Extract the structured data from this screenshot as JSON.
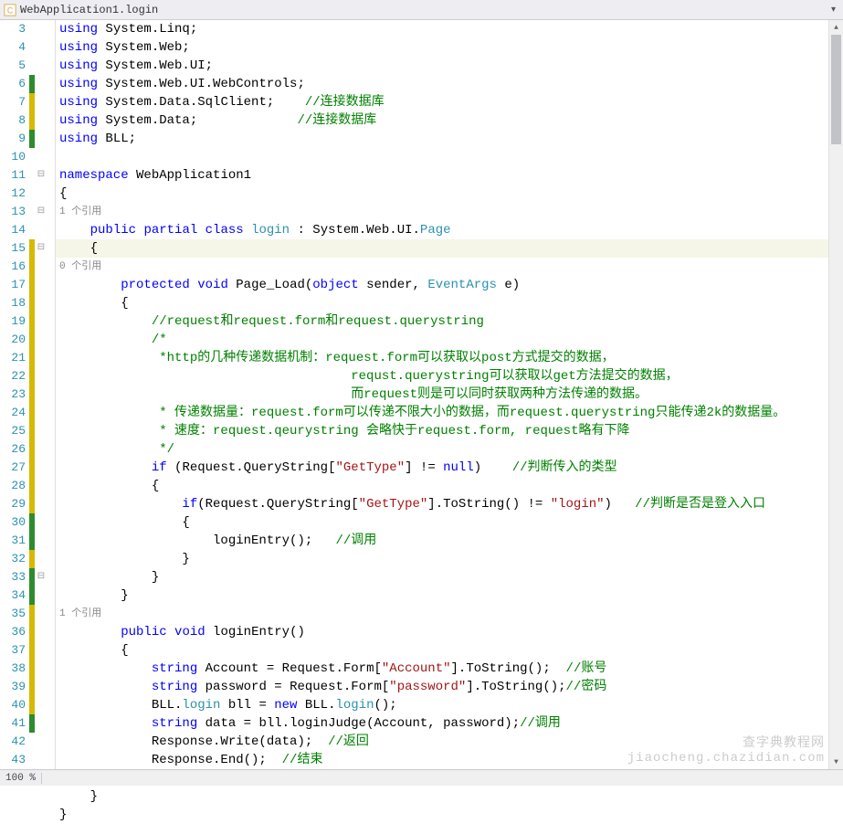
{
  "title": "WebApplication1.login",
  "bottom_tab": "100 %",
  "watermark": "查字典教程网\njiaocheng.chazidian.com",
  "refs": {
    "one": "1 个引用",
    "zero": "0 个引用"
  },
  "code": {
    "l3": {
      "num": "3",
      "marker": "",
      "fold": "",
      "tokens": [
        {
          "c": "kw",
          "t": "using"
        },
        {
          "c": "txt",
          "t": " System.Linq;"
        }
      ]
    },
    "l4": {
      "num": "4",
      "marker": "",
      "fold": "",
      "tokens": [
        {
          "c": "kw",
          "t": "using"
        },
        {
          "c": "txt",
          "t": " System.Web;"
        }
      ]
    },
    "l5": {
      "num": "5",
      "marker": "",
      "fold": "",
      "tokens": [
        {
          "c": "kw",
          "t": "using"
        },
        {
          "c": "txt",
          "t": " System.Web.UI;"
        }
      ]
    },
    "l6": {
      "num": "6",
      "marker": "m-green",
      "fold": "",
      "tokens": [
        {
          "c": "kw",
          "t": "using"
        },
        {
          "c": "txt",
          "t": " System.Web.UI.WebControls;"
        }
      ]
    },
    "l7": {
      "num": "7",
      "marker": "m-yellow",
      "fold": "",
      "tokens": [
        {
          "c": "kw",
          "t": "using"
        },
        {
          "c": "txt",
          "t": " System.Data.SqlClient;    "
        },
        {
          "c": "com",
          "t": "//连接数据库"
        }
      ]
    },
    "l8": {
      "num": "8",
      "marker": "m-yellow",
      "fold": "",
      "tokens": [
        {
          "c": "kw",
          "t": "using"
        },
        {
          "c": "txt",
          "t": " System.Data;             "
        },
        {
          "c": "com",
          "t": "//连接数据库"
        }
      ]
    },
    "l9": {
      "num": "9",
      "marker": "m-green",
      "fold": "",
      "tokens": [
        {
          "c": "kw",
          "t": "using"
        },
        {
          "c": "txt",
          "t": " BLL;"
        }
      ]
    },
    "l10": {
      "num": "10",
      "marker": "",
      "fold": "",
      "tokens": [
        {
          "c": "txt",
          "t": ""
        }
      ]
    },
    "l11": {
      "num": "11",
      "marker": "",
      "fold": "⊟",
      "tokens": [
        {
          "c": "kw",
          "t": "namespace"
        },
        {
          "c": "txt",
          "t": " WebApplication1"
        }
      ]
    },
    "l12": {
      "num": "12",
      "marker": "",
      "fold": "",
      "tokens": [
        {
          "c": "txt",
          "t": "{"
        }
      ]
    },
    "r1": {
      "indent": "        ",
      "ref": "one"
    },
    "l13": {
      "num": "13",
      "marker": "",
      "fold": "⊟",
      "tokens": [
        {
          "c": "txt",
          "t": "    "
        },
        {
          "c": "kw",
          "t": "public"
        },
        {
          "c": "txt",
          "t": " "
        },
        {
          "c": "kw",
          "t": "partial"
        },
        {
          "c": "txt",
          "t": " "
        },
        {
          "c": "kw",
          "t": "class"
        },
        {
          "c": "txt",
          "t": " "
        },
        {
          "c": "type",
          "t": "login"
        },
        {
          "c": "txt",
          "t": " : System.Web.UI."
        },
        {
          "c": "type",
          "t": "Page"
        }
      ]
    },
    "l14": {
      "num": "14",
      "marker": "",
      "fold": "",
      "highlight": true,
      "tokens": [
        {
          "c": "txt",
          "t": "    {"
        }
      ]
    },
    "r2": {
      "indent": "            ",
      "ref": "zero"
    },
    "l15": {
      "num": "15",
      "marker": "m-yellow",
      "fold": "⊟",
      "tokens": [
        {
          "c": "txt",
          "t": "        "
        },
        {
          "c": "kw",
          "t": "protected"
        },
        {
          "c": "txt",
          "t": " "
        },
        {
          "c": "kw",
          "t": "void"
        },
        {
          "c": "txt",
          "t": " Page_Load("
        },
        {
          "c": "kw",
          "t": "object"
        },
        {
          "c": "txt",
          "t": " sender, "
        },
        {
          "c": "type",
          "t": "EventArgs"
        },
        {
          "c": "txt",
          "t": " e)"
        }
      ]
    },
    "l16": {
      "num": "16",
      "marker": "m-yellow",
      "fold": "",
      "tokens": [
        {
          "c": "txt",
          "t": "        {"
        }
      ]
    },
    "l17": {
      "num": "17",
      "marker": "m-yellow",
      "fold": "",
      "tokens": [
        {
          "c": "txt",
          "t": "            "
        },
        {
          "c": "com",
          "t": "//request和request.form和request.querystring"
        }
      ]
    },
    "l18": {
      "num": "18",
      "marker": "m-yellow",
      "fold": "",
      "tokens": [
        {
          "c": "txt",
          "t": "            "
        },
        {
          "c": "com",
          "t": "/*"
        }
      ]
    },
    "l19": {
      "num": "19",
      "marker": "m-yellow",
      "fold": "",
      "tokens": [
        {
          "c": "txt",
          "t": "             "
        },
        {
          "c": "com",
          "t": "*http的几种传递数据机制：request.form可以获取以post方式提交的数据，"
        }
      ]
    },
    "l20": {
      "num": "20",
      "marker": "m-yellow",
      "fold": "",
      "tokens": [
        {
          "c": "txt",
          "t": "             "
        },
        {
          "c": "com",
          "t": "                         requst.querystring可以获取以get方法提交的数据，"
        }
      ]
    },
    "l21": {
      "num": "21",
      "marker": "m-yellow",
      "fold": "",
      "tokens": [
        {
          "c": "txt",
          "t": "             "
        },
        {
          "c": "com",
          "t": "                         而request则是可以同时获取两种方法传递的数据。"
        }
      ]
    },
    "l22": {
      "num": "22",
      "marker": "m-yellow",
      "fold": "",
      "tokens": [
        {
          "c": "txt",
          "t": "             "
        },
        {
          "c": "com",
          "t": "* 传递数据量：request.form可以传递不限大小的数据，而request.querystring只能传递2k的数据量。"
        }
      ]
    },
    "l23": {
      "num": "23",
      "marker": "m-yellow",
      "fold": "",
      "tokens": [
        {
          "c": "txt",
          "t": "             "
        },
        {
          "c": "com",
          "t": "* 速度：request.qeurystring 会略快于request.form, request略有下降"
        }
      ]
    },
    "l24": {
      "num": "24",
      "marker": "m-yellow",
      "fold": "",
      "tokens": [
        {
          "c": "txt",
          "t": "             "
        },
        {
          "c": "com",
          "t": "*/"
        }
      ]
    },
    "l25": {
      "num": "25",
      "marker": "m-yellow",
      "fold": "",
      "tokens": [
        {
          "c": "txt",
          "t": "            "
        },
        {
          "c": "kw",
          "t": "if"
        },
        {
          "c": "txt",
          "t": " (Request.QueryString["
        },
        {
          "c": "str",
          "t": "\"GetType\""
        },
        {
          "c": "txt",
          "t": "] != "
        },
        {
          "c": "kw",
          "t": "null"
        },
        {
          "c": "txt",
          "t": ")    "
        },
        {
          "c": "com",
          "t": "//判断传入的类型"
        }
      ]
    },
    "l26": {
      "num": "26",
      "marker": "m-yellow",
      "fold": "",
      "tokens": [
        {
          "c": "txt",
          "t": "            {"
        }
      ]
    },
    "l27": {
      "num": "27",
      "marker": "m-yellow",
      "fold": "",
      "tokens": [
        {
          "c": "txt",
          "t": "                "
        },
        {
          "c": "kw",
          "t": "if"
        },
        {
          "c": "txt",
          "t": "(Request.QueryString["
        },
        {
          "c": "str",
          "t": "\"GetType\""
        },
        {
          "c": "txt",
          "t": "].ToString() != "
        },
        {
          "c": "str",
          "t": "\"login\""
        },
        {
          "c": "txt",
          "t": ")   "
        },
        {
          "c": "com",
          "t": "//判断是否是登入入口"
        }
      ]
    },
    "l28": {
      "num": "28",
      "marker": "m-yellow",
      "fold": "",
      "tokens": [
        {
          "c": "txt",
          "t": "                {"
        }
      ]
    },
    "l29": {
      "num": "29",
      "marker": "m-yellow",
      "fold": "",
      "tokens": [
        {
          "c": "txt",
          "t": "                    loginEntry();   "
        },
        {
          "c": "com",
          "t": "//调用"
        }
      ]
    },
    "l30": {
      "num": "30",
      "marker": "m-green",
      "fold": "",
      "tokens": [
        {
          "c": "txt",
          "t": "                }"
        }
      ]
    },
    "l31": {
      "num": "31",
      "marker": "m-green",
      "fold": "",
      "tokens": [
        {
          "c": "txt",
          "t": "            }"
        }
      ]
    },
    "l32": {
      "num": "32",
      "marker": "m-yellow",
      "fold": "",
      "tokens": [
        {
          "c": "txt",
          "t": "        }"
        }
      ]
    },
    "r3": {
      "indent": "        ",
      "ref": "one"
    },
    "l33": {
      "num": "33",
      "marker": "m-green",
      "fold": "⊟",
      "tokens": [
        {
          "c": "txt",
          "t": "        "
        },
        {
          "c": "kw",
          "t": "public"
        },
        {
          "c": "txt",
          "t": " "
        },
        {
          "c": "kw",
          "t": "void"
        },
        {
          "c": "txt",
          "t": " loginEntry()"
        }
      ]
    },
    "l34": {
      "num": "34",
      "marker": "m-green",
      "fold": "",
      "tokens": [
        {
          "c": "txt",
          "t": "        {"
        }
      ]
    },
    "l35": {
      "num": "35",
      "marker": "m-yellow",
      "fold": "",
      "tokens": [
        {
          "c": "txt",
          "t": "            "
        },
        {
          "c": "kw",
          "t": "string"
        },
        {
          "c": "txt",
          "t": " Account = Request.Form["
        },
        {
          "c": "str",
          "t": "\"Account\""
        },
        {
          "c": "txt",
          "t": "].ToString();  "
        },
        {
          "c": "com",
          "t": "//账号"
        }
      ]
    },
    "l36": {
      "num": "36",
      "marker": "m-yellow",
      "fold": "",
      "tokens": [
        {
          "c": "txt",
          "t": "            "
        },
        {
          "c": "kw",
          "t": "string"
        },
        {
          "c": "txt",
          "t": " password = Request.Form["
        },
        {
          "c": "str",
          "t": "\"password\""
        },
        {
          "c": "txt",
          "t": "].ToString();"
        },
        {
          "c": "com",
          "t": "//密码"
        }
      ]
    },
    "l37": {
      "num": "37",
      "marker": "m-yellow",
      "fold": "",
      "tokens": [
        {
          "c": "txt",
          "t": "            BLL."
        },
        {
          "c": "type",
          "t": "login"
        },
        {
          "c": "txt",
          "t": " bll = "
        },
        {
          "c": "kw",
          "t": "new"
        },
        {
          "c": "txt",
          "t": " BLL."
        },
        {
          "c": "type",
          "t": "login"
        },
        {
          "c": "txt",
          "t": "();"
        }
      ]
    },
    "l38": {
      "num": "38",
      "marker": "m-yellow",
      "fold": "",
      "tokens": [
        {
          "c": "txt",
          "t": "            "
        },
        {
          "c": "kw",
          "t": "string"
        },
        {
          "c": "txt",
          "t": " data = bll.loginJudge(Account, password);"
        },
        {
          "c": "com",
          "t": "//调用"
        }
      ]
    },
    "l39": {
      "num": "39",
      "marker": "m-yellow",
      "fold": "",
      "tokens": [
        {
          "c": "txt",
          "t": "            Response.Write(data);  "
        },
        {
          "c": "com",
          "t": "//返回"
        }
      ]
    },
    "l40": {
      "num": "40",
      "marker": "m-yellow",
      "fold": "",
      "tokens": [
        {
          "c": "txt",
          "t": "            Response.End();  "
        },
        {
          "c": "com",
          "t": "//结束"
        }
      ]
    },
    "l41": {
      "num": "41",
      "marker": "m-green",
      "fold": "",
      "tokens": [
        {
          "c": "txt",
          "t": "        }"
        }
      ]
    },
    "l42": {
      "num": "42",
      "marker": "",
      "fold": "",
      "tokens": [
        {
          "c": "txt",
          "t": "    }"
        }
      ]
    },
    "l43": {
      "num": "43",
      "marker": "",
      "fold": "",
      "tokens": [
        {
          "c": "txt",
          "t": "}"
        }
      ]
    }
  },
  "order": [
    "l3",
    "l4",
    "l5",
    "l6",
    "l7",
    "l8",
    "l9",
    "l10",
    "l11",
    "l12",
    "r1",
    "l13",
    "l14",
    "r2",
    "l15",
    "l16",
    "l17",
    "l18",
    "l19",
    "l20",
    "l21",
    "l22",
    "l23",
    "l24",
    "l25",
    "l26",
    "l27",
    "l28",
    "l29",
    "l30",
    "l31",
    "l32",
    "r3",
    "l33",
    "l34",
    "l35",
    "l36",
    "l37",
    "l38",
    "l39",
    "l40",
    "l41",
    "l42",
    "l43"
  ]
}
